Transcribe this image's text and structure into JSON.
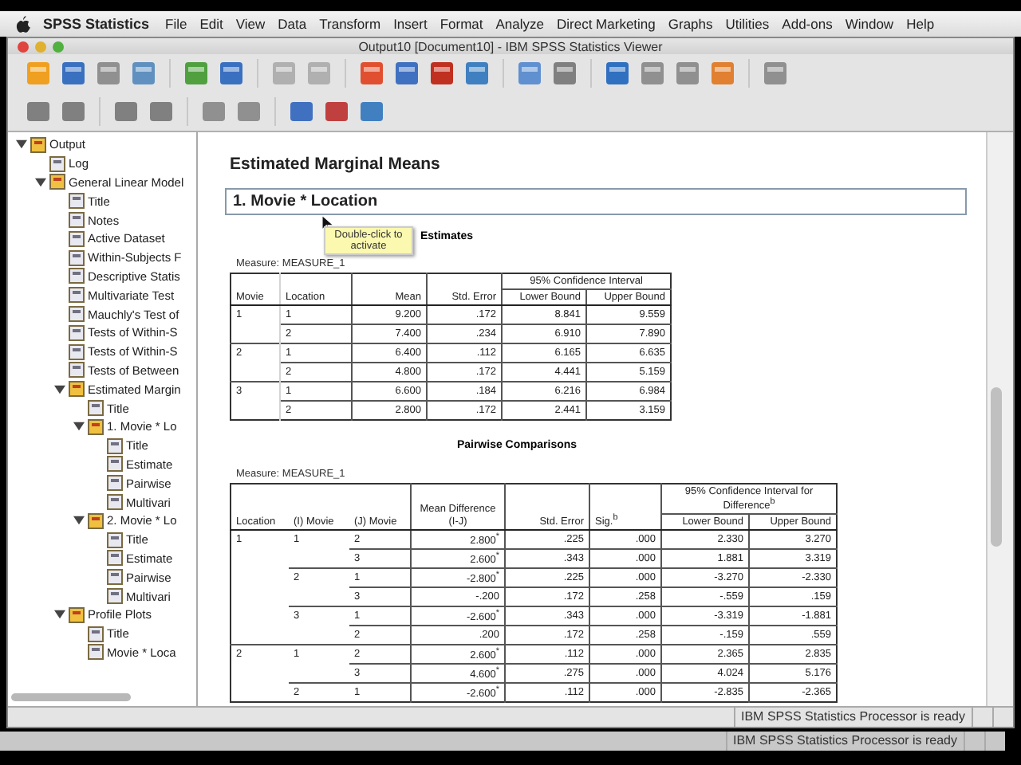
{
  "menu_bar": {
    "app_name": "SPSS Statistics",
    "items": [
      "File",
      "Edit",
      "View",
      "Data",
      "Transform",
      "Insert",
      "Format",
      "Analyze",
      "Direct Marketing",
      "Graphs",
      "Utilities",
      "Add-ons",
      "Window",
      "Help"
    ]
  },
  "window": {
    "title": "Output10 [Document10] - IBM SPSS Statistics Viewer"
  },
  "outline": [
    {
      "label": "Output",
      "expanded": true,
      "children": [
        {
          "label": "Log"
        },
        {
          "label": "General Linear Model",
          "expanded": true,
          "children": [
            {
              "label": "Title"
            },
            {
              "label": "Notes"
            },
            {
              "label": "Active Dataset"
            },
            {
              "label": "Within-Subjects F"
            },
            {
              "label": "Descriptive Statis"
            },
            {
              "label": "Multivariate Test"
            },
            {
              "label": "Mauchly's Test of"
            },
            {
              "label": "Tests of Within-S"
            },
            {
              "label": "Tests of Within-S"
            },
            {
              "label": "Tests of Between"
            },
            {
              "label": "Estimated Margin",
              "expanded": true,
              "children": [
                {
                  "label": "Title"
                },
                {
                  "label": "1. Movie * Lo",
                  "expanded": true,
                  "children": [
                    {
                      "label": "Title"
                    },
                    {
                      "label": "Estimate"
                    },
                    {
                      "label": "Pairwise"
                    },
                    {
                      "label": "Multivari"
                    }
                  ]
                },
                {
                  "label": "2. Movie * Lo",
                  "expanded": true,
                  "children": [
                    {
                      "label": "Title"
                    },
                    {
                      "label": "Estimate"
                    },
                    {
                      "label": "Pairwise"
                    },
                    {
                      "label": "Multivari"
                    }
                  ]
                }
              ]
            },
            {
              "label": "Profile Plots",
              "expanded": true,
              "children": [
                {
                  "label": "Title"
                },
                {
                  "label": "Movie * Loca"
                }
              ]
            }
          ]
        }
      ]
    }
  ],
  "content": {
    "heading": "Estimated Marginal Means",
    "subheading": "1. Movie * Location",
    "tooltip": "Double-click to activate",
    "estimates": {
      "title": "Estimates",
      "measure": "Measure: MEASURE_1",
      "group_header": "95% Confidence Interval",
      "columns": [
        "Movie",
        "Location",
        "Mean",
        "Std. Error",
        "Lower Bound",
        "Upper Bound"
      ],
      "rows": [
        [
          "1",
          "1",
          "9.200",
          ".172",
          "8.841",
          "9.559"
        ],
        [
          "",
          "2",
          "7.400",
          ".234",
          "6.910",
          "7.890"
        ],
        [
          "2",
          "1",
          "6.400",
          ".112",
          "6.165",
          "6.635"
        ],
        [
          "",
          "2",
          "4.800",
          ".172",
          "4.441",
          "5.159"
        ],
        [
          "3",
          "1",
          "6.600",
          ".184",
          "6.216",
          "6.984"
        ],
        [
          "",
          "2",
          "2.800",
          ".172",
          "2.441",
          "3.159"
        ]
      ]
    },
    "pairwise": {
      "title": "Pairwise Comparisons",
      "measure": "Measure: MEASURE_1",
      "group_header": "95% Confidence Interval for Difference$^{b}$",
      "columns": [
        "Location",
        "(I) Movie",
        "(J) Movie",
        "Mean Difference (I-J)",
        "Std. Error",
        "Sig.$^{b}$",
        "Lower Bound",
        "Upper Bound"
      ],
      "rows": [
        [
          "1",
          "1",
          "2",
          "2.800$^{*}$",
          ".225",
          ".000",
          "2.330",
          "3.270"
        ],
        [
          "",
          "",
          "3",
          "2.600$^{*}$",
          ".343",
          ".000",
          "1.881",
          "3.319"
        ],
        [
          "",
          "2",
          "1",
          "-2.800$^{*}$",
          ".225",
          ".000",
          "-3.270",
          "-2.330"
        ],
        [
          "",
          "",
          "3",
          "-.200",
          ".172",
          ".258",
          "-.559",
          ".159"
        ],
        [
          "",
          "3",
          "1",
          "-2.600$^{*}$",
          ".343",
          ".000",
          "-3.319",
          "-1.881"
        ],
        [
          "",
          "",
          "2",
          ".200",
          ".172",
          ".258",
          "-.159",
          ".559"
        ],
        [
          "2",
          "1",
          "2",
          "2.600$^{*}$",
          ".112",
          ".000",
          "2.365",
          "2.835"
        ],
        [
          "",
          "",
          "3",
          "4.600$^{*}$",
          ".275",
          ".000",
          "4.024",
          "5.176"
        ],
        [
          "",
          "2",
          "1",
          "-2.600$^{*}$",
          ".112",
          ".000",
          "-2.835",
          "-2.365"
        ]
      ]
    }
  },
  "status_bar": "IBM SPSS Statistics Processor is ready",
  "background_status_bar": "IBM SPSS Statistics Processor is ready"
}
